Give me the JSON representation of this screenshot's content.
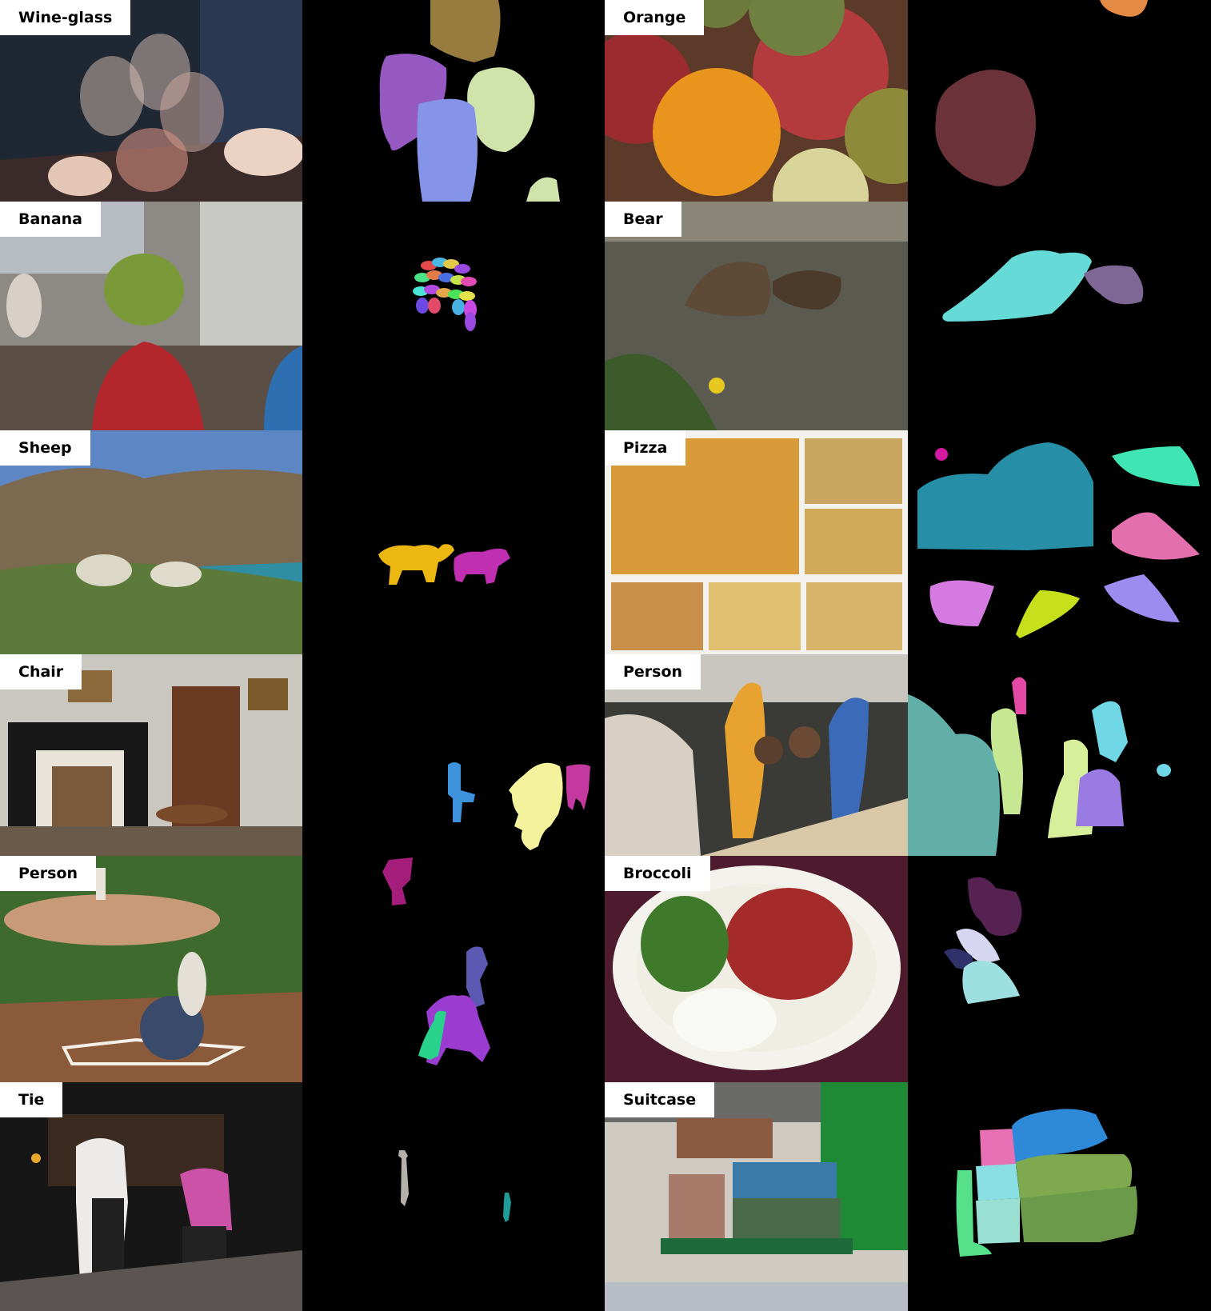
{
  "panels": [
    {
      "label": "Wine-glass"
    },
    {
      "label": "Orange"
    },
    {
      "label": "Banana"
    },
    {
      "label": "Bear"
    },
    {
      "label": "Sheep"
    },
    {
      "label": "Pizza"
    },
    {
      "label": "Chair"
    },
    {
      "label": "Person"
    },
    {
      "label": "Person"
    },
    {
      "label": "Broccoli"
    },
    {
      "label": "Tie"
    },
    {
      "label": "Suitcase"
    }
  ]
}
